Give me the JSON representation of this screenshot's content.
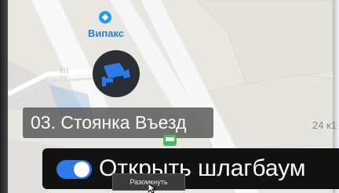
{
  "map": {
    "poi_name": "Випакс",
    "place_label": "03. Стоянка Въезд",
    "house_number": "24 к1",
    "colors": {
      "background": "#e9e7e2",
      "road": "#ffffff",
      "accent": "#2b9be3"
    }
  },
  "icons": {
    "poi": "diamond-pin-icon",
    "camera": "security-camera-icon",
    "bus": "bus-stop-icon"
  },
  "action_bar": {
    "toggle_on": true,
    "label": "Открыть шлагбаум",
    "toggle_color": "#2f79ea"
  },
  "tooltip": {
    "text": "Разомкнуть"
  }
}
